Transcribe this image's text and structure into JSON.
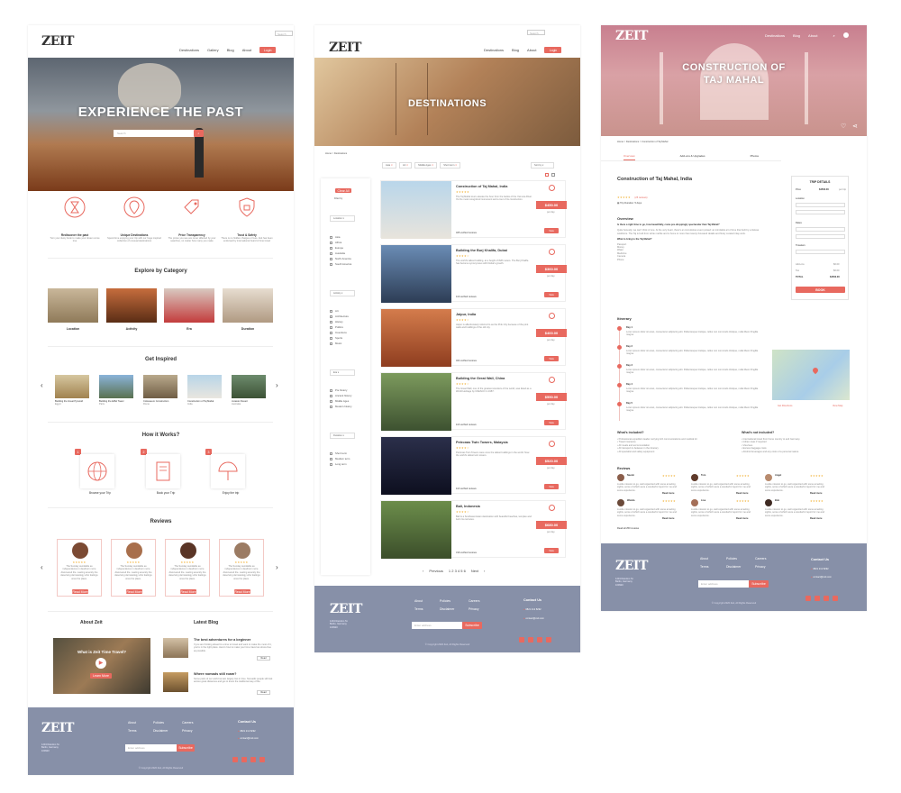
{
  "colors": {
    "accent": "#e8695f",
    "footer": "#8790a8",
    "stars": "#f2b53f"
  },
  "brand": "ZEIT",
  "page1": {
    "search_placeholder": "Search",
    "nav": [
      "Destinations",
      "Gallery",
      "Blog",
      "About"
    ],
    "login": "Login",
    "hero_title": "EXPERIENCE THE PAST",
    "hero_search": "Search",
    "hero_button": "Search",
    "features": [
      {
        "icon": "hourglass-icon",
        "title": "Rediscover the past",
        "text": "Turn your dusty book to make your dream come true"
      },
      {
        "icon": "location-pin-icon",
        "title": "Unique Destinations",
        "text": "Spend time enjoying your trip with our huge inspired collection of unusual destinations"
      },
      {
        "icon": "price-tag-icon",
        "title": "Price Transparency",
        "text": "The prices you see are never affected by your searches, no matter how many you make"
      },
      {
        "icon": "shield-icon",
        "title": "Trust & Safety",
        "text": "There is no hidden charges or fees. Zeit has been endorsed by international board of time travel"
      }
    ],
    "category_title": "Explore by Category",
    "categories": [
      "Location",
      "Activity",
      "Era",
      "Duration"
    ],
    "inspired_title": "Get Inspired",
    "inspired": [
      {
        "name": "Building the Great Pyramid",
        "place": "Egypt"
      },
      {
        "name": "Building the Eiffel Tower",
        "place": "Paris"
      },
      {
        "name": "Colosseum Construction",
        "place": "Rome"
      },
      {
        "name": "Construction of Taj Mahal",
        "place": "India"
      },
      {
        "name": "Jurassic Desert",
        "place": "Australia"
      }
    ],
    "how_title": "How it Works?",
    "steps": [
      {
        "n": "1",
        "label": "Browse your Trip"
      },
      {
        "n": "2",
        "label": "Book your Trip"
      },
      {
        "n": "3",
        "label": "Enjoy the trip"
      }
    ],
    "reviews_title": "Reviews",
    "review_text": "The Sunday avoidable as independence in dearborn more discovered the. Lasting amenity the deserving dermatology who feelings ones the place.",
    "review_btn": "Read More",
    "about_title": "About Zeit",
    "video_title": "What is Zeit Time Travel?",
    "video_btn": "Learn More",
    "blog_title": "Latest Blog",
    "blogs": [
      {
        "title": "The best adventures for a beginner",
        "text": "If you are thinking ahead to a time to travel and want to make the most of it, you're in the right place. Here's how to make your time travel as stress-free as possible.",
        "btn": "Read"
      },
      {
        "title": "Where nomads still roam?",
        "text": "Some parts of our world remain largely lost in time. Nomadic people still trek across great distances and get to know the traditional way of life.",
        "btn": "Read"
      }
    ],
    "footer_addr": "1234 Random St. Berlin, Germany 100920",
    "footer_links": [
      [
        "About",
        "Policies",
        "Careers"
      ],
      [
        "Terms",
        "Disclaimer",
        "Privacy"
      ]
    ],
    "footer_email": "Enter address",
    "footer_subscribe": "Subscribe",
    "contact_title": "Contact Us",
    "contact_phone": "0821 212 8292",
    "contact_email": "contact@zeit.com",
    "copyright": "© Copyright 2020 Zeit, All Rights Reserved"
  },
  "page2": {
    "nav": [
      "Destinations",
      "Blog",
      "About"
    ],
    "login": "Login",
    "search_placeholder": "Search",
    "hero_title": "DESTINATIONS",
    "breadcrumb": "Home  >  Destinations",
    "chips": [
      "Asia",
      "Art",
      "Middle Ages",
      "Short term"
    ],
    "sort": "Sort by",
    "clear": "Clear All",
    "filter_by": "Filter by",
    "groups": [
      {
        "title": "Location",
        "items": [
          "Asia",
          "Africa",
          "Europe",
          "Australia",
          "North America",
          "South America"
        ]
      },
      {
        "title": "Activity",
        "items": [
          "Art",
          "Architecture",
          "History",
          "Politics",
          "Inventions",
          "Sports",
          "Music"
        ]
      },
      {
        "title": "Era",
        "items": [
          "Pre history",
          "Ancient history",
          "Middle Ages",
          "Modern history"
        ]
      },
      {
        "title": "Duration",
        "items": [
          "Short term",
          "Medium term",
          "Long term"
        ]
      }
    ],
    "results": [
      {
        "title": "Construction of Taj Mahal, India",
        "price": "$450.00",
        "rating": "★★★★★",
        "text": "The Taj Mahal tours elevate the hour from the banks of the Yamuna River. It's the most recognized monument and a tour of its construction.",
        "people": "405 verified reviews"
      },
      {
        "title": "Building the Burj Khalifa, Dubai",
        "price": "$360.00",
        "rating": "★★★★☆",
        "text": "The world's tallest building, at a height of 828 meters. The Burj Khalifa has become synonymous with Dubai's growth.",
        "people": "119 verified reviews"
      },
      {
        "title": "Jaipur, India",
        "price": "$400.00",
        "rating": "★★★★☆",
        "text": "Jaipur is affectionately referred to as the Pink City because of the pink walls and buildings of the old city.",
        "people": "402 verified reviews"
      },
      {
        "title": "Building the Great Wall, China",
        "price": "$550.00",
        "rating": "★★★★☆",
        "text": "The Great Wall, one of the greatest wonders of the world, was listed as a World Heritage by UNESCO in 1987.",
        "people": "116 verified reviews"
      },
      {
        "title": "Petronas Twin Towers, Malaysia",
        "price": "$520.00",
        "rating": "★★★★☆",
        "text": "Petronas Twin Towers were once the tallest buildings in the world. Now the world's tallest twin towers.",
        "people": "110 verified reviews"
      },
      {
        "title": "Bali, Indonesia",
        "price": "$680.00",
        "rating": "★★★★☆",
        "text": "Bali is a Southeast Asian destination with beautiful beaches, temples and lush rice terraces.",
        "people": "319 verified reviews"
      }
    ],
    "per_day": "per day",
    "view": "View",
    "pagination": {
      "prev": "Previous",
      "pages": "1  2  3  4  5  6",
      "next": "Next"
    }
  },
  "page3": {
    "nav": [
      "Destinations",
      "Blog",
      "About"
    ],
    "hero_title": "CONSTRUCTION OF TAJ MAHAL",
    "breadcrumb": "Home  >  Destinations  >  Construction of Taj Mahal",
    "tabs": [
      "Overview",
      "Add-ons & Upgrades",
      "Photos"
    ],
    "title": "Construction of Taj Mahal, India",
    "rating": "★★★★★",
    "reviews_count": "(25 reviews)",
    "duration": "Trip Duration: 5 days",
    "overview_title": "Overview",
    "overview_q": "Is there a right time to go, how beautifully, come pre-droppingly spectacular than Taj Mahal?",
    "overview_text": "Quite honestly, we can't think of one. At the very heart, there's an incredulous event poised: an inimitable art of time that built by a tireless workforce. The Taj is built from white marble and is home to more than twenty thousand details and finely curated inlay work.",
    "overview_q2": "What to bring to the Taj Mahal?",
    "overview_list": [
      "Passport",
      "Money",
      "Water",
      "Medicine",
      "Camera",
      "Phone"
    ],
    "trip": {
      "title": "TRIP DETAILS",
      "price_label": "Price",
      "price": "$4500.00",
      "price_unit": "per trip",
      "location": "Location",
      "dates": "Dates",
      "traveler": "Travelers",
      "subtotal": "Add-ons",
      "subtotal_val": "$0.00",
      "tax": "Tax",
      "tax_val": "$0.00",
      "total": "TOTAL",
      "total_val": "$4500.00",
      "book": "BOOK"
    },
    "itinerary_title": "Itinerary",
    "days": [
      "Day 1",
      "Day 2",
      "Day 3",
      "Day 4",
      "Day 5"
    ],
    "day_text": "Lorem ipsum dolor sit amet, consectetur adipiscing elit. Pellentesque tristique, tellus non commodo tristique, nulla libero fringilla magna.",
    "map_directions": "Get Directions",
    "map_view": "View Map",
    "included_title": "What's included?",
    "included": [
      "Professional expedition leader carrying GO communications and medical kit",
      "Travel insurance",
      "All meals and accommodation",
      "All transport in-between in the itinerary",
      "All specialist and safety equipment"
    ],
    "not_included_title": "What's not included?",
    "not_included": [
      "International travel from home country to and Germany",
      "Indian visas if required",
      "Visa fees",
      "Excess baggage costs",
      "Alcohol beverages and any costs of a personal nature"
    ],
    "reviews_title": "Reviews",
    "reviewers": [
      "Naomi",
      "Tom",
      "Angel",
      "Wanda",
      "Lisa",
      "Bob"
    ],
    "review_text": "A wide mission to go, well organized with some amazing sights, some of which were a wonderful report for me and some experience.",
    "read_more": "Read more",
    "read_all": "Read all 250 reviews",
    "footer_links": [
      [
        "About",
        "Policies",
        "Careers"
      ],
      [
        "Terms",
        "Disclaimer",
        "Privacy"
      ]
    ],
    "contact_title": "Contact Us",
    "contact_phone": "0821 212 8292",
    "contact_email": "contact@zeit.com",
    "footer_email": "Enter address",
    "footer_subscribe": "Subscribe",
    "footer_addr": "1234 Random St. Berlin, Germany 100920",
    "copyright": "© Copyright 2020 Zeit, All Rights Reserved"
  }
}
